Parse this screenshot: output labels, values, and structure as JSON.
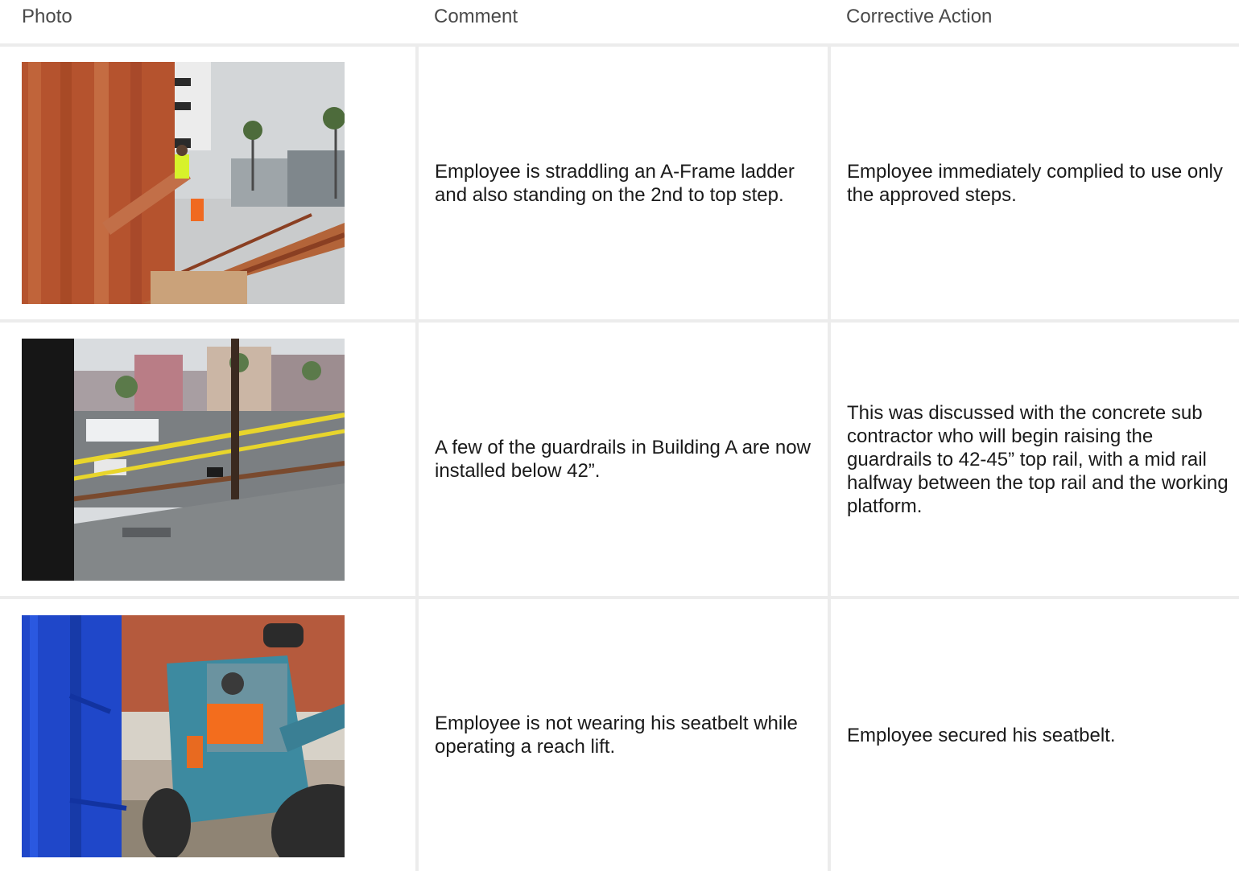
{
  "header": {
    "photo": "Photo",
    "comment": "Comment",
    "action": "Corrective Action"
  },
  "rows": [
    {
      "photo": "ladder-framing-photo",
      "comment": "Employee is straddling an A-Frame ladder and also standing on the 2nd to top step.",
      "action": "Employee immediately complied to use only the approved steps."
    },
    {
      "photo": "guardrail-photo",
      "comment": "A few of the guardrails in Building A are now installed below 42”.",
      "action": "This was discussed with the concrete sub contractor who will begin raising the guardrails to 42-45” top rail, with a mid rail halfway between the top rail and the working platform."
    },
    {
      "photo": "reach-lift-photo",
      "comment": "Employee is not wearing his seatbelt while operating a reach lift.",
      "action": "Employee secured his seatbelt."
    }
  ]
}
